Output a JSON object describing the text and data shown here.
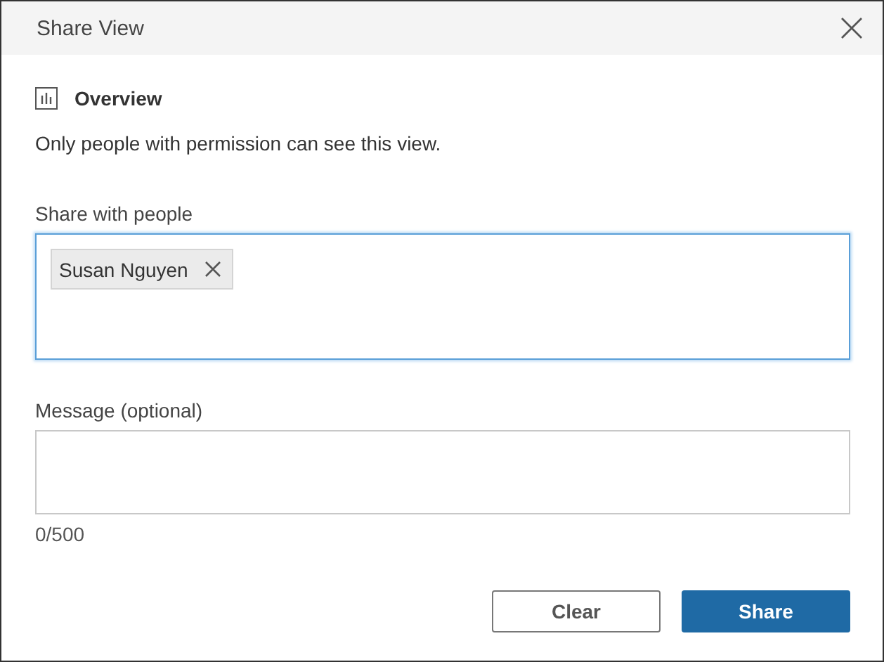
{
  "dialog": {
    "title": "Share View"
  },
  "view": {
    "name": "Overview"
  },
  "notice": "Only people with permission can see this view.",
  "share_with": {
    "label": "Share with people",
    "focused": true,
    "recipients": [
      {
        "name": "Susan Nguyen"
      }
    ]
  },
  "message": {
    "label": "Message (optional)",
    "counter": "0/500"
  },
  "buttons": [
    {
      "label": "Clear",
      "kind": "secondary"
    },
    {
      "label": "Share",
      "kind": "primary"
    }
  ]
}
